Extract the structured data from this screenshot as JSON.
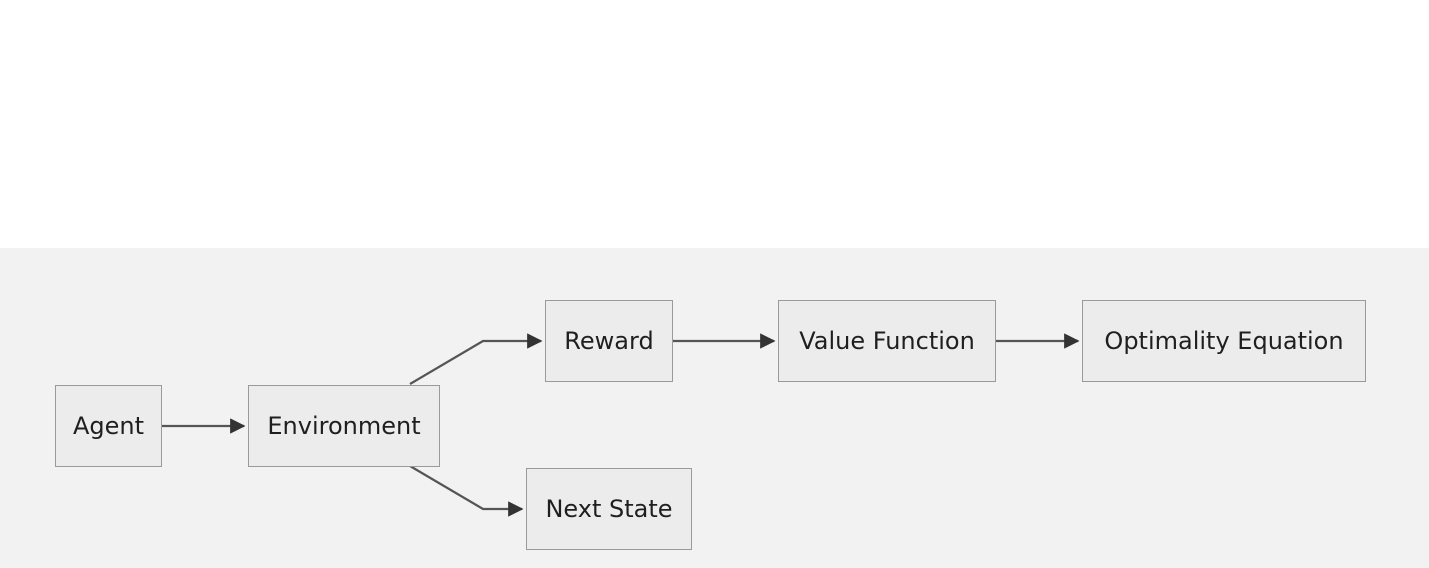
{
  "diagram": {
    "nodes": {
      "agent": "Agent",
      "environment": "Environment",
      "reward": "Reward",
      "next_state": "Next State",
      "value_function": "Value Function",
      "optimality_equation": "Optimality Equation"
    },
    "edges": [
      {
        "from": "Agent",
        "to": "Environment"
      },
      {
        "from": "Environment",
        "to": "Reward"
      },
      {
        "from": "Environment",
        "to": "Next State"
      },
      {
        "from": "Reward",
        "to": "Value Function"
      },
      {
        "from": "Value Function",
        "to": "Optimality Equation"
      }
    ],
    "colors": {
      "canvas": "#f2f2f2",
      "node_fill": "#ececec",
      "node_border": "#9a9a9a",
      "edge": "#555555"
    }
  }
}
